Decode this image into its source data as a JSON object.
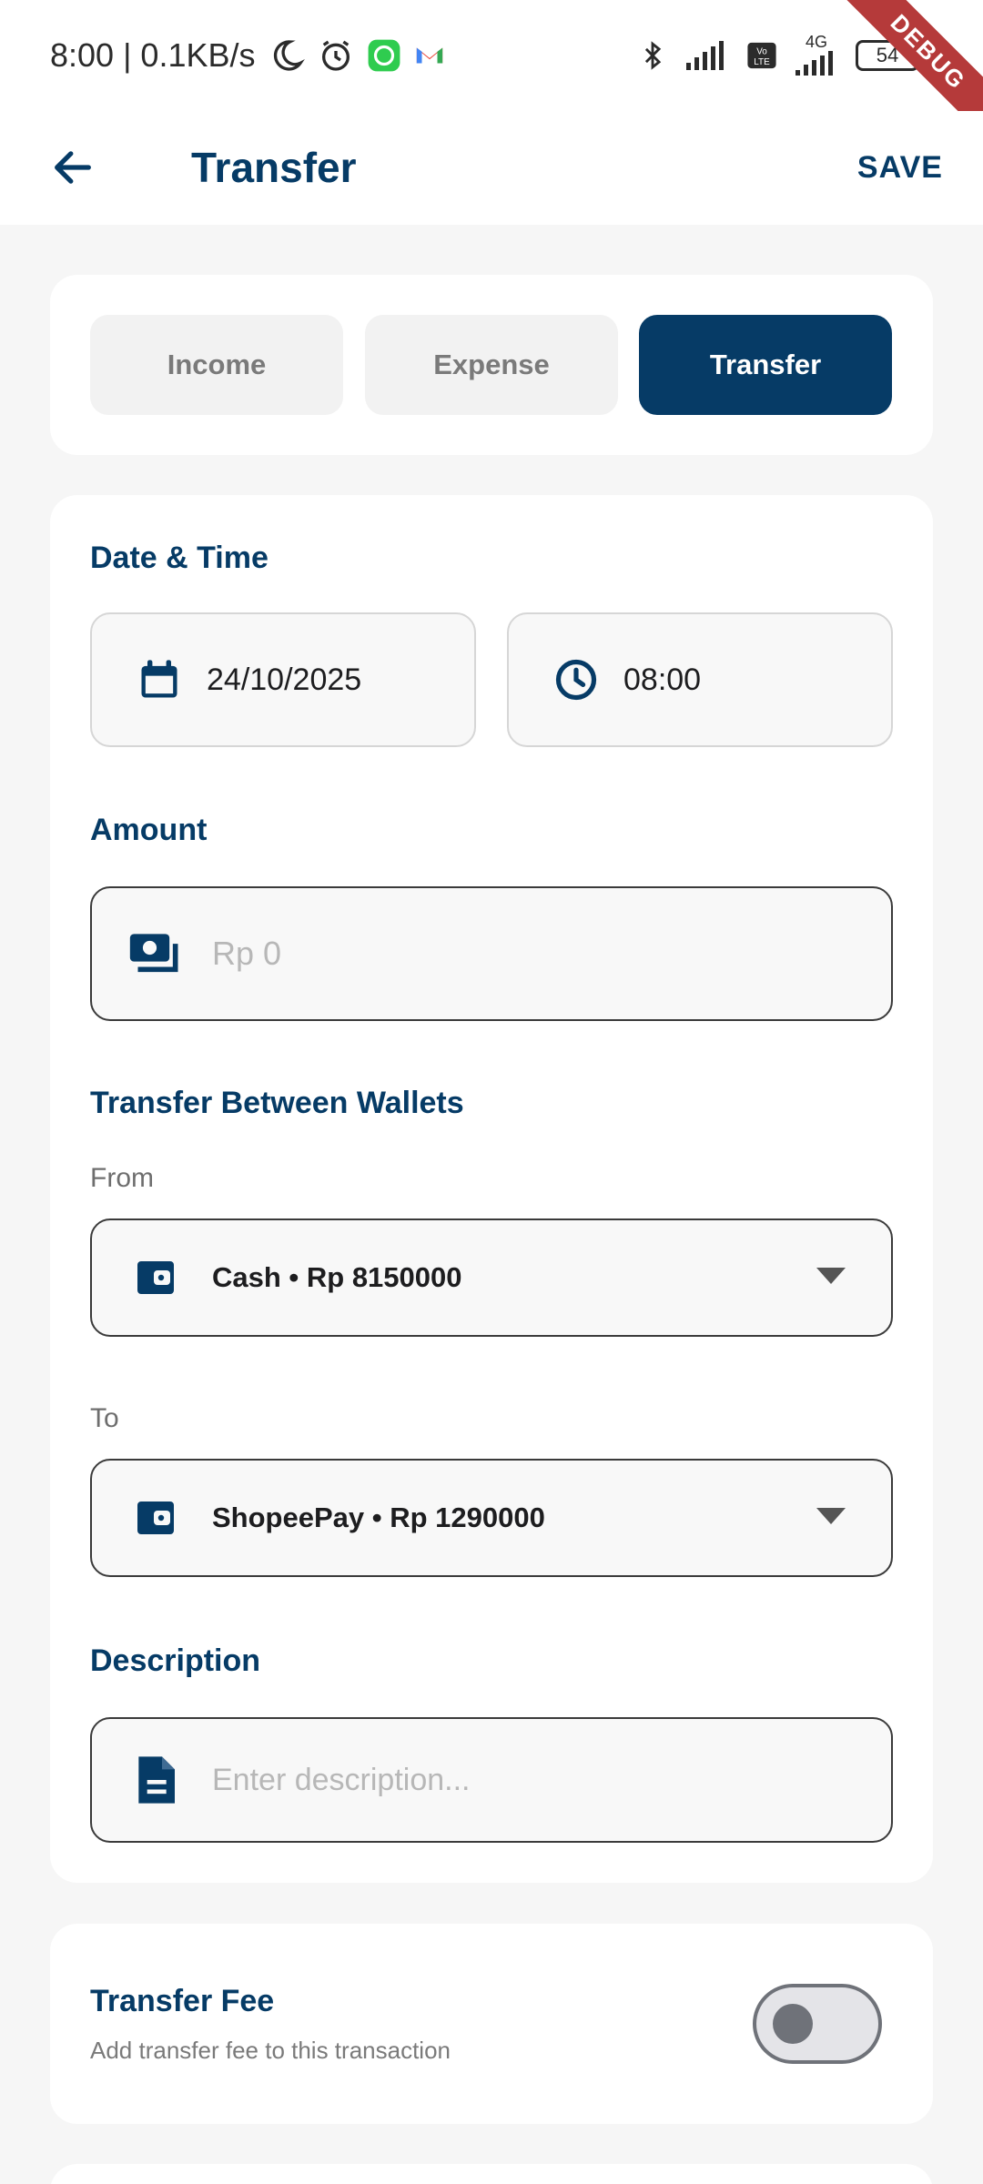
{
  "status_bar": {
    "time_speed": "8:00 | 0.1KB/s",
    "network": "4G",
    "battery": "54"
  },
  "debug_banner": "DEBUG",
  "app_bar": {
    "title": "Transfer",
    "save_label": "SAVE"
  },
  "type_selector": {
    "options": [
      "Income",
      "Expense",
      "Transfer"
    ],
    "selected": "Transfer"
  },
  "form": {
    "date_time_label": "Date & Time",
    "date_value": "24/10/2025",
    "time_value": "08:00",
    "amount_label": "Amount",
    "amount_placeholder": "Rp 0",
    "wallets_label": "Transfer Between Wallets",
    "from_label": "From",
    "from_value": "Cash • Rp 8150000",
    "to_label": "To",
    "to_value": "ShopeePay • Rp 1290000",
    "description_label": "Description",
    "description_placeholder": "Enter description..."
  },
  "fee": {
    "title": "Transfer Fee",
    "description": "Add transfer fee to this transaction",
    "enabled": false
  },
  "colors": {
    "primary": "#063b66",
    "background": "#f6f6f6",
    "card": "#ffffff"
  }
}
